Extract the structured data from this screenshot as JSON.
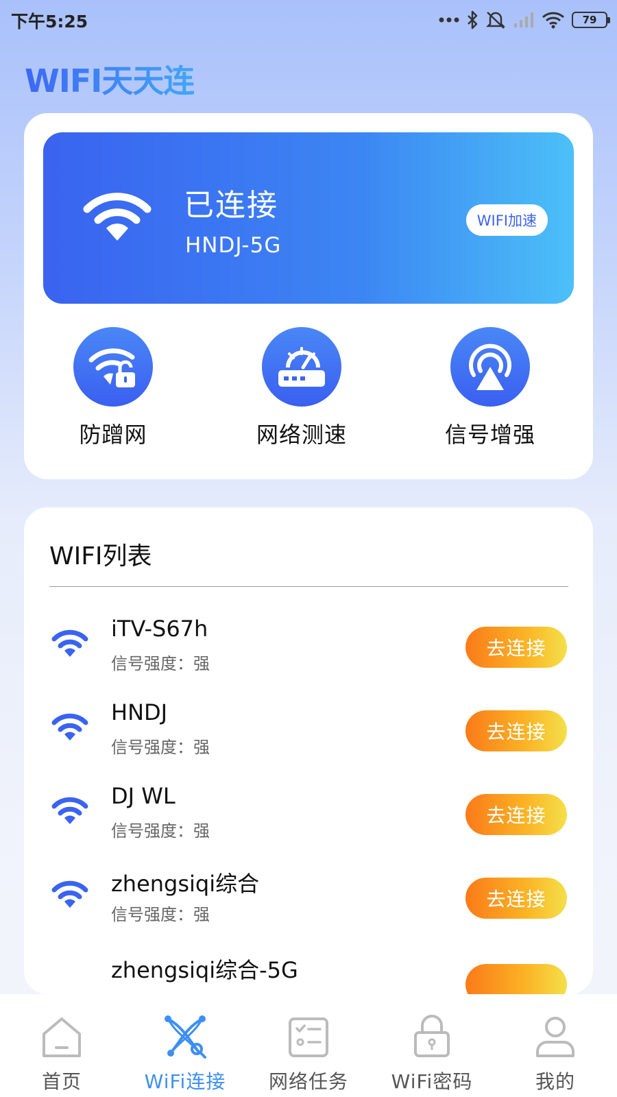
{
  "status_bar": {
    "time": "下午5:25",
    "battery": "79",
    "icons": [
      "more-dots-icon",
      "bluetooth-icon",
      "mute-icon",
      "cellular-signal-icon",
      "wifi-status-icon",
      "battery-icon"
    ]
  },
  "app": {
    "title": "WIFI天天连"
  },
  "connection": {
    "status": "已连接",
    "ssid": "HNDJ-5G",
    "boost_label": "WIFI加速",
    "icon": "wifi-icon"
  },
  "features": [
    {
      "label": "防蹭网",
      "icon": "wifi-lock-icon"
    },
    {
      "label": "网络测速",
      "icon": "router-speed-icon"
    },
    {
      "label": "信号增强",
      "icon": "signal-broadcast-icon"
    }
  ],
  "wifi_list": {
    "title": "WIFI列表",
    "items": [
      {
        "name": "iTV-S67h",
        "signal": "信号强度：强",
        "action": "去连接"
      },
      {
        "name": "HNDJ",
        "signal": "信号强度：强",
        "action": "去连接"
      },
      {
        "name": "DJ WL",
        "signal": "信号强度：强",
        "action": "去连接"
      },
      {
        "name": "zhengsiqi综合",
        "signal": "信号强度：强",
        "action": "去连接"
      }
    ],
    "partial_item": {
      "name": "zhengsiqi综合-5G"
    }
  },
  "bottom_nav": [
    {
      "label": "首页",
      "icon": "home-icon",
      "active": false
    },
    {
      "label": "WiFi连接",
      "icon": "wifi-connect-icon",
      "active": true
    },
    {
      "label": "网络任务",
      "icon": "task-list-icon",
      "active": false
    },
    {
      "label": "WiFi密码",
      "icon": "lock-icon",
      "active": false
    },
    {
      "label": "我的",
      "icon": "user-icon",
      "active": false
    }
  ],
  "colors": {
    "primary_blue": "#3a63f0",
    "banner_end": "#4cc0f8",
    "button_orange": "#fb7a19",
    "button_yellow": "#f4e04a",
    "nav_active": "#3d8ff2"
  }
}
